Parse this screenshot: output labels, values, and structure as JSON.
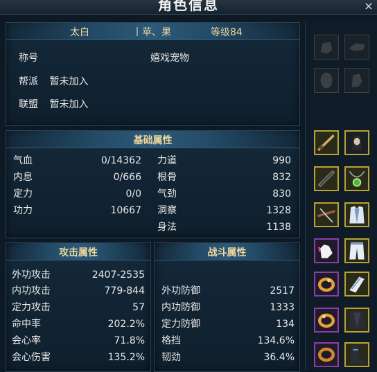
{
  "window": {
    "title": "角色信息",
    "close_label": "×"
  },
  "profile": {
    "name": "太白",
    "school": "丨苹、果",
    "level": "等级84",
    "title_label": "称号",
    "title_value": "嬉戏宠物",
    "guild_label": "帮派",
    "guild_value": "暂未加入",
    "alliance_label": "联盟",
    "alliance_value": "暂未加入"
  },
  "basic": {
    "header": "基础属性",
    "left": [
      {
        "label": "气血",
        "value": "0/14362"
      },
      {
        "label": "内息",
        "value": "0/666"
      },
      {
        "label": "定力",
        "value": "0/0"
      },
      {
        "label": "功力",
        "value": "10667"
      }
    ],
    "right": [
      {
        "label": "力道",
        "value": "990"
      },
      {
        "label": "根骨",
        "value": "832"
      },
      {
        "label": "气劲",
        "value": "830"
      },
      {
        "label": "洞察",
        "value": "1328"
      },
      {
        "label": "身法",
        "value": "1138"
      }
    ]
  },
  "attack": {
    "header": "攻击属性",
    "rows": [
      {
        "label": "外功攻击",
        "value": "2407-2535"
      },
      {
        "label": "内功攻击",
        "value": "779-844"
      },
      {
        "label": "定力攻击",
        "value": "57"
      },
      {
        "label": "命中率",
        "value": "202.2%"
      },
      {
        "label": "会心率",
        "value": "71.8%"
      },
      {
        "label": "会心伤害",
        "value": "135.2%"
      }
    ]
  },
  "combat": {
    "header": "战斗属性",
    "rows": [
      {
        "label": "外功防御",
        "value": "2517"
      },
      {
        "label": "内功防御",
        "value": "1333"
      },
      {
        "label": "定力防御",
        "value": "134"
      },
      {
        "label": "格挡",
        "value": "134.6%"
      },
      {
        "label": "韧劲",
        "value": "36.4%"
      }
    ]
  },
  "equipment": {
    "slots": [
      {
        "name": "empty-slot-glove",
        "quality": "empty"
      },
      {
        "name": "empty-slot-bracer",
        "quality": "empty"
      },
      {
        "name": "empty-slot-mask",
        "quality": "empty"
      },
      {
        "name": "empty-slot-gauntlet",
        "quality": "empty"
      },
      {
        "name": "weapon-blade-icon",
        "quality": "yellow"
      },
      {
        "name": "head-hair-icon",
        "quality": "yellow"
      },
      {
        "name": "weapon-staff-icon",
        "quality": "yellow"
      },
      {
        "name": "necklace-icon",
        "quality": "yellow"
      },
      {
        "name": "crossbow-icon",
        "quality": "yellow"
      },
      {
        "name": "armor-icon",
        "quality": "yellow"
      },
      {
        "name": "glove-icon",
        "quality": "purple"
      },
      {
        "name": "pants-icon",
        "quality": "yellow"
      },
      {
        "name": "ring-icon",
        "quality": "purple"
      },
      {
        "name": "bracer-icon",
        "quality": "yellow"
      },
      {
        "name": "ring-icon",
        "quality": "purple"
      },
      {
        "name": "cape-icon",
        "quality": "yellow"
      },
      {
        "name": "bracelet-icon",
        "quality": "purple"
      },
      {
        "name": "boots-icon",
        "quality": "yellow"
      }
    ]
  }
}
